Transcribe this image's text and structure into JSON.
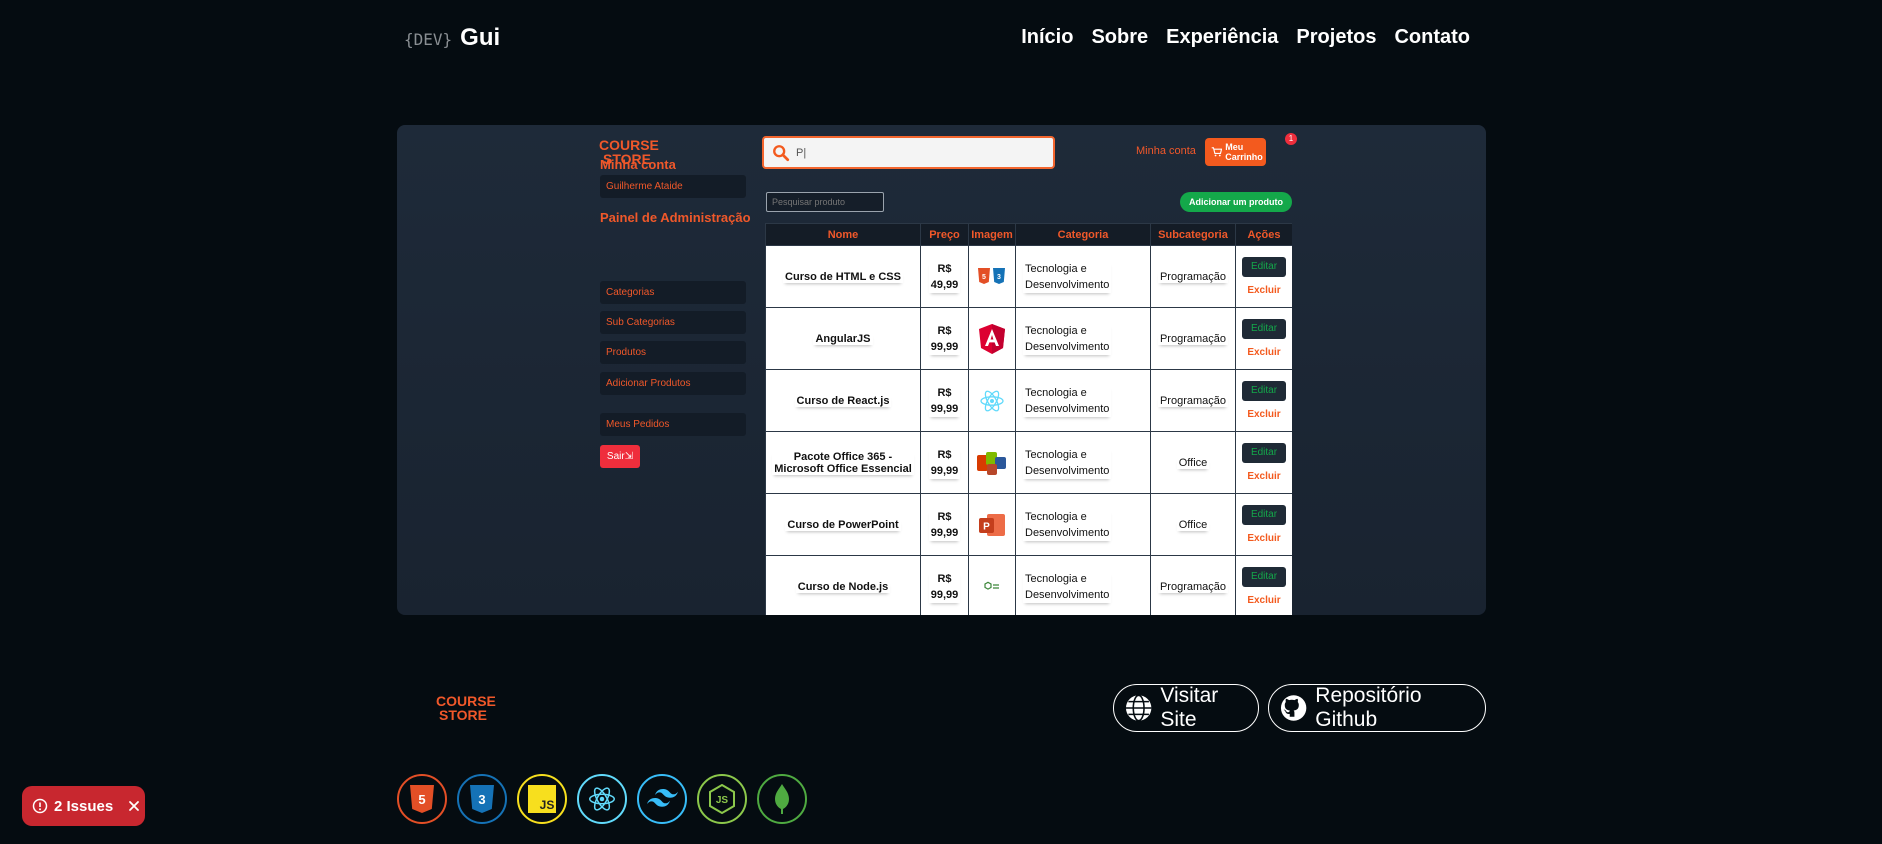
{
  "header": {
    "logo_prefix": "{DEV}",
    "logo_name": "Gui",
    "nav": [
      "Início",
      "Sobre",
      "Experiência",
      "Projetos",
      "Contato"
    ]
  },
  "store": {
    "logo_line1": "COURSE",
    "logo_line2": "STORE",
    "search_value": "P|",
    "account_link": "Minha conta",
    "cart_label": "Meu Carrinho",
    "cart_count": "1",
    "sidebar": {
      "account_heading": "Minha conta",
      "user_name": "Guilherme Ataide",
      "admin_heading": "Painel de Administração",
      "items": [
        "Categorias",
        "Sub Categorias",
        "Produtos",
        "Adicionar Produtos"
      ],
      "orders": "Meus Pedidos",
      "logout": "Sair"
    },
    "product_search_placeholder": "Pesquisar produto",
    "add_product_label": "Adicionar um produto",
    "table": {
      "headers": [
        "Nome",
        "Preço",
        "Imagem",
        "Categoria",
        "Subcategoria",
        "Ações"
      ],
      "rows": [
        {
          "name": "Curso de HTML e CSS",
          "price_a": "R$",
          "price_b": "49,99",
          "icon": "html-css-icon",
          "cat1": "Tecnologia e",
          "cat2": "Desenvolvimento",
          "sub": "Programação"
        },
        {
          "name": "AngularJS",
          "price_a": "R$",
          "price_b": "99,99",
          "icon": "angular-icon",
          "cat1": "Tecnologia e",
          "cat2": "Desenvolvimento",
          "sub": "Programação"
        },
        {
          "name": "Curso de React.js",
          "price_a": "R$",
          "price_b": "99,99",
          "icon": "react-icon",
          "cat1": "Tecnologia e",
          "cat2": "Desenvolvimento",
          "sub": "Programação"
        },
        {
          "name1": "Pacote Office 365 -",
          "name2": "Microsoft Office Essencial",
          "price_a": "R$",
          "price_b": "99,99",
          "icon": "office-icon",
          "cat1": "Tecnologia e",
          "cat2": "Desenvolvimento",
          "sub": "Office"
        },
        {
          "name": "Curso de PowerPoint",
          "price_a": "R$",
          "price_b": "99,99",
          "icon": "powerpoint-icon",
          "cat1": "Tecnologia e",
          "cat2": "Desenvolvimento",
          "sub": "Office"
        },
        {
          "name": "Curso de Node.js",
          "price_a": "R$",
          "price_b": "99,99",
          "icon": "nodejs-icon",
          "cat1": "Tecnologia e",
          "cat2": "Desenvolvimento",
          "sub": "Programação"
        }
      ],
      "edit_label": "Editar",
      "delete_label": "Excluir"
    }
  },
  "footer": {
    "logo_line1": "COURSE",
    "logo_line2": "STORE",
    "visit_label": "Visitar Site",
    "repo_label": "Repositório Github",
    "techs": [
      {
        "icon": "html5-icon",
        "color": "#e34f26"
      },
      {
        "icon": "css3-icon",
        "color": "#1572b6"
      },
      {
        "icon": "javascript-icon",
        "color": "#f7df1e"
      },
      {
        "icon": "react-icon",
        "color": "#61dafb"
      },
      {
        "icon": "tailwind-icon",
        "color": "#38bdf8"
      },
      {
        "icon": "nodejs-icon",
        "color": "#8cc84b"
      },
      {
        "icon": "mongodb-icon",
        "color": "#4faa41"
      }
    ]
  },
  "issues_label": "2 Issues",
  "colors": {
    "accent": "#f0582a",
    "background": "#050c11",
    "panel": "#1e2a39",
    "success": "#14a84a",
    "danger": "#ef2e3c"
  }
}
